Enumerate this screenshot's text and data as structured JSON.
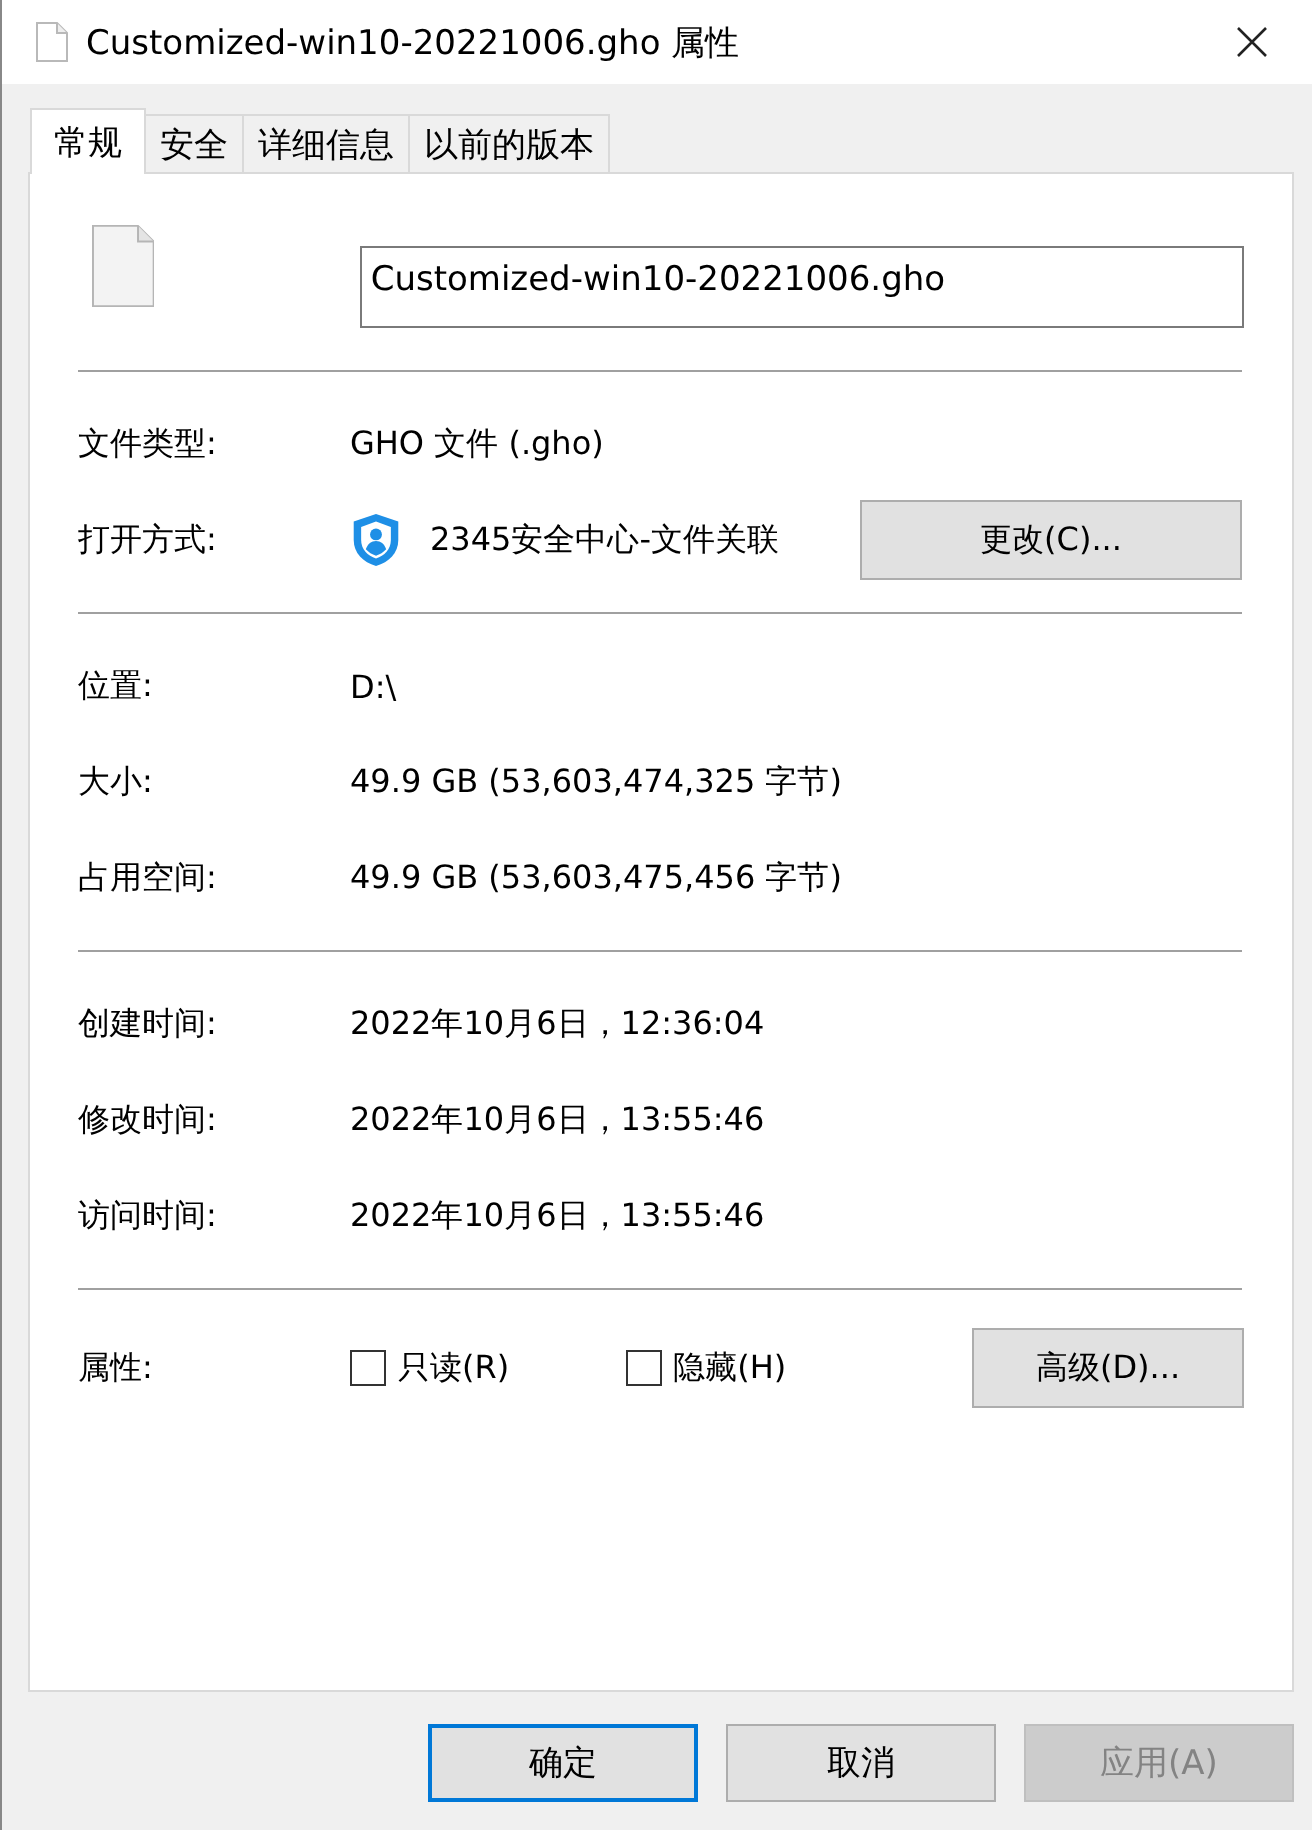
{
  "window": {
    "title": "Customized-win10-20221006.gho 属性"
  },
  "tabs": [
    {
      "label": "常规",
      "selected": true
    },
    {
      "label": "安全",
      "selected": false
    },
    {
      "label": "详细信息",
      "selected": false
    },
    {
      "label": "以前的版本",
      "selected": false
    }
  ],
  "file_name": {
    "value": "Customized-win10-20221006.gho"
  },
  "sections": [
    {
      "rows": [
        {
          "kind": "text",
          "label": "文件类型:",
          "value": "GHO 文件 (.gho)"
        },
        {
          "kind": "app",
          "label": "打开方式:",
          "value": "2345安全中心-文件关联",
          "button": "更改(C)..."
        }
      ]
    },
    {
      "rows": [
        {
          "kind": "text",
          "label": "位置:",
          "value": "D:\\"
        },
        {
          "kind": "text",
          "label": "大小:",
          "value": "49.9 GB (53,603,474,325 字节)"
        },
        {
          "kind": "text",
          "label": "占用空间:",
          "value": "49.9 GB (53,603,475,456 字节)"
        }
      ]
    },
    {
      "rows": [
        {
          "kind": "text",
          "label": "创建时间:",
          "value": "2022年10月6日，12:36:04"
        },
        {
          "kind": "text",
          "label": "修改时间:",
          "value": "2022年10月6日，13:55:46"
        },
        {
          "kind": "text",
          "label": "访问时间:",
          "value": "2022年10月6日，13:55:46"
        }
      ]
    }
  ],
  "attributes": {
    "label": "属性:",
    "checkboxes": [
      {
        "label": "只读(R)",
        "checked": false
      },
      {
        "label": "隐藏(H)",
        "checked": false
      }
    ],
    "button": "高级(D)..."
  },
  "buttons": [
    {
      "label": "确定",
      "default": true,
      "disabled": false
    },
    {
      "label": "取消",
      "default": false,
      "disabled": false
    },
    {
      "label": "应用(A)",
      "default": false,
      "disabled": true
    }
  ]
}
